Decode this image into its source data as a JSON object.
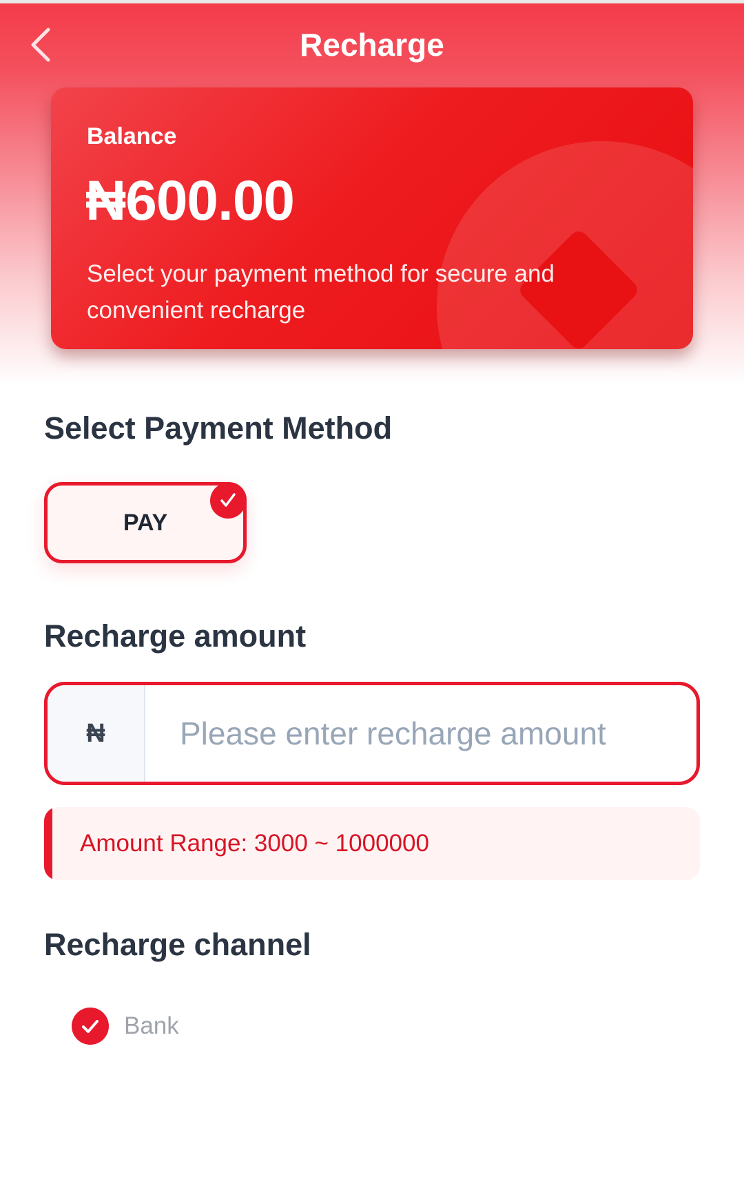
{
  "header": {
    "title": "Recharge",
    "back_icon": "chevron-left-icon"
  },
  "balance_card": {
    "label": "Balance",
    "amount": "₦600.00",
    "note": "Select your payment method for secure and convenient recharge"
  },
  "payment_method": {
    "section_title": "Select Payment Method",
    "options": [
      {
        "label": "PAY",
        "selected": true
      }
    ]
  },
  "recharge_amount": {
    "section_title": "Recharge amount",
    "currency_symbol": "₦",
    "placeholder": "Please enter recharge amount",
    "value": "",
    "range_text": "Amount Range: 3000 ~ 1000000"
  },
  "recharge_channel": {
    "section_title": "Recharge channel",
    "options": [
      {
        "label": "Bank",
        "selected": true
      }
    ]
  },
  "colors": {
    "accent": "#e8192d",
    "header_gradient_top": "#f43a49",
    "card_red": "#ee1c1f",
    "heading_text": "#2b3442",
    "placeholder_text": "#98a6b8",
    "range_text": "#d81424",
    "range_bg": "#fff3f3",
    "muted_text": "#9fa4ab"
  }
}
